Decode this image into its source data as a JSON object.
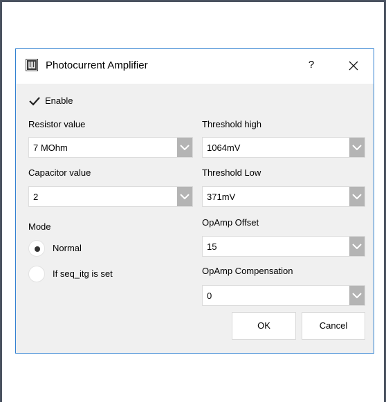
{
  "dialog": {
    "title": "Photocurrent Amplifier",
    "help_label": "?",
    "enable": {
      "label": "Enable",
      "checked": true
    },
    "resistor": {
      "label": "Resistor value",
      "value": "7 MOhm"
    },
    "capacitor": {
      "label": "Capacitor value",
      "value": "2"
    },
    "mode": {
      "label": "Mode",
      "options": [
        {
          "label": "Normal",
          "selected": true
        },
        {
          "label": "If seq_itg is set",
          "selected": false
        }
      ]
    },
    "threshold_high": {
      "label": "Threshold high",
      "value": "1064mV"
    },
    "threshold_low": {
      "label": "Threshold Low",
      "value": "371mV"
    },
    "opamp_offset": {
      "label": "OpAmp Offset",
      "value": "15"
    },
    "opamp_compensation": {
      "label": "OpAmp Compensation",
      "value": "0"
    },
    "ok_label": "OK",
    "cancel_label": "Cancel"
  },
  "icons": [
    "app-icon",
    "help-icon",
    "close-icon",
    "checkmark-icon",
    "chevron-down-icon"
  ]
}
